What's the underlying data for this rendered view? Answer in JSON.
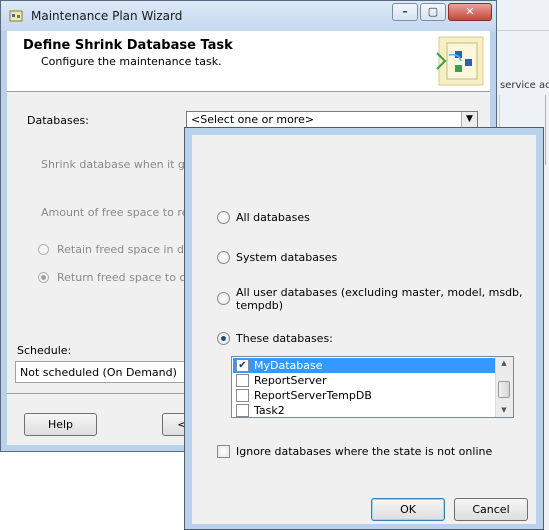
{
  "wizard": {
    "title": "Maintenance Plan Wizard",
    "header_title": "Define Shrink Database Task",
    "header_subtitle": "Configure the maintenance task.",
    "databases_label": "Databases:",
    "databases_value": "<Select one or more>",
    "shrink_label": "Shrink database when it grows",
    "free_space_label": "Amount of free space to remain",
    "retain_label": "Retain freed space in datab",
    "return_label": "Return freed space to oper",
    "schedule_label": "Schedule:",
    "schedule_value": "Not scheduled (On Demand)",
    "help_button": "Help",
    "back_button": "<"
  },
  "background_app": {
    "text": "service acc"
  },
  "popup": {
    "options": {
      "all": "All databases",
      "system": "System databases",
      "user_line1": "All user databases  (excluding master, model, msdb,",
      "user_line2": "tempdb)",
      "these": "These databases:"
    },
    "selected_option": "these",
    "databases": [
      {
        "name": "MyDatabase",
        "checked": true,
        "selected": true
      },
      {
        "name": "ReportServer",
        "checked": false,
        "selected": false
      },
      {
        "name": "ReportServerTempDB",
        "checked": false,
        "selected": false
      },
      {
        "name": "Task2",
        "checked": false,
        "selected": false
      }
    ],
    "ignore_label": "Ignore databases where the state is not online",
    "ok_button": "OK",
    "cancel_button": "Cancel"
  },
  "colors": {
    "window_frame": "#b9d1ea",
    "selection": "#3399ff"
  }
}
